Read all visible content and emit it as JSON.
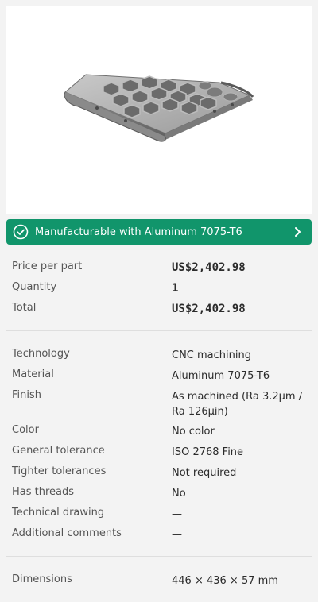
{
  "banner": {
    "text": "Manufacturable with Aluminum 7075-T6",
    "color": "#11956b",
    "icon": "check-circle-icon",
    "chevron": "chevron-right-icon"
  },
  "pricing": {
    "price_label": "Price per part",
    "price_value": "US$2,402.98",
    "quantity_label": "Quantity",
    "quantity_value": "1",
    "total_label": "Total",
    "total_value": "US$2,402.98"
  },
  "specs": [
    {
      "label": "Technology",
      "value": "CNC machining"
    },
    {
      "label": "Material",
      "value": "Aluminum 7075-T6"
    },
    {
      "label": "Finish",
      "value": "As machined (Ra 3.2μm / Ra 126μin)"
    },
    {
      "label": "Color",
      "value": "No color"
    },
    {
      "label": "General tolerance",
      "value": "ISO 2768 Fine"
    },
    {
      "label": "Tighter tolerances",
      "value": "Not required"
    },
    {
      "label": "Has threads",
      "value": "No"
    },
    {
      "label": "Technical drawing",
      "value": "—"
    },
    {
      "label": "Additional comments",
      "value": "—"
    }
  ],
  "dimensions": {
    "label": "Dimensions",
    "value": "446 × 436 × 57 mm"
  }
}
